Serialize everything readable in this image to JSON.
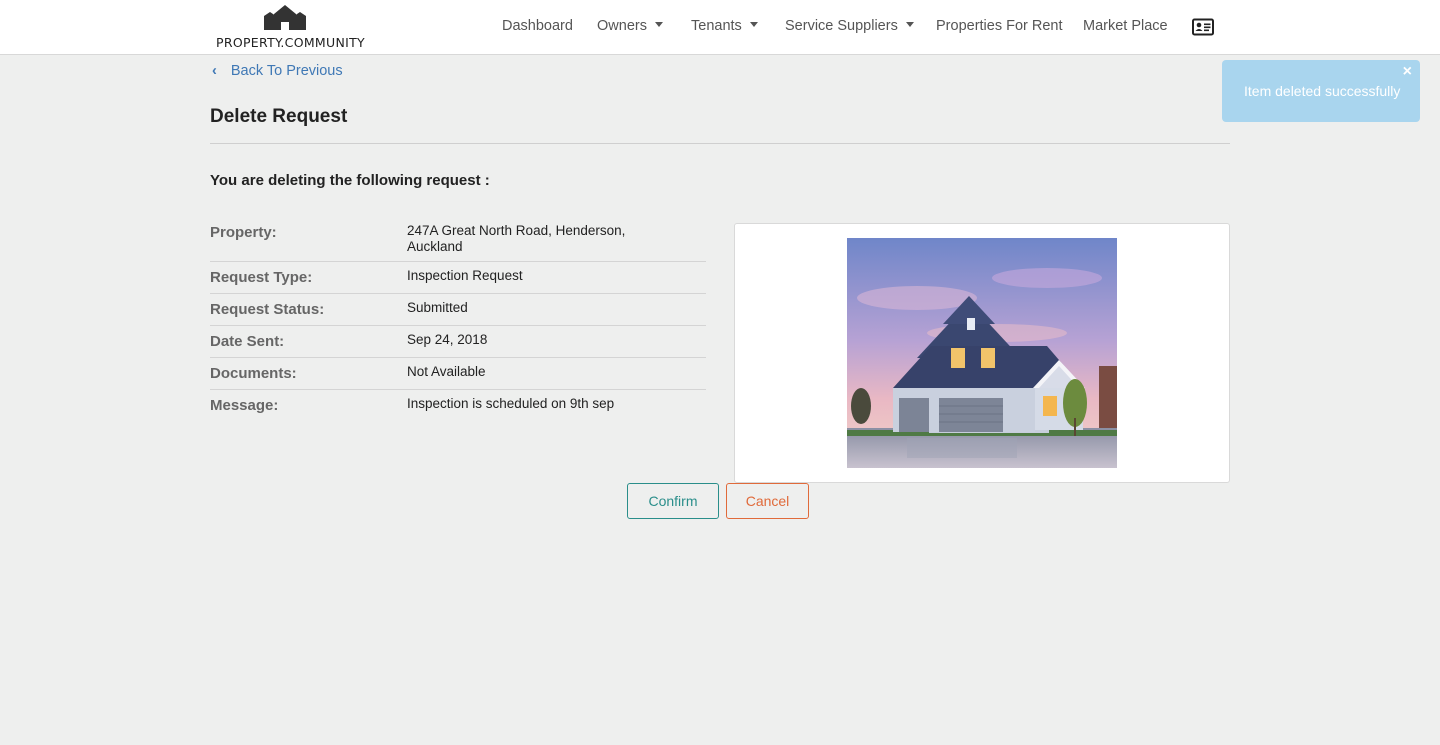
{
  "brand": {
    "name": "PROPERTY.COMMUNITY"
  },
  "nav": {
    "items": [
      {
        "label": "Dashboard"
      },
      {
        "label": "Owners"
      },
      {
        "label": "Tenants"
      },
      {
        "label": "Service Suppliers"
      },
      {
        "label": "Properties For Rent"
      },
      {
        "label": "Market Place"
      }
    ],
    "profile_icon": "id-card-icon"
  },
  "toast": {
    "message": "Item deleted successfully",
    "close": "×",
    "color": "#a9d5ee"
  },
  "back_link": {
    "label": "Back To Previous"
  },
  "page": {
    "title": "Delete Request",
    "intro": "You are deleting the following request :"
  },
  "details": {
    "property_label": "Property:",
    "property_value": "247A Great North Road, Henderson, Auckland",
    "type_label": "Request Type:",
    "type_value": "Inspection Request",
    "status_label": "Request Status:",
    "status_value": "Submitted",
    "date_label": "Date Sent:",
    "date_value": "Sep 24, 2018",
    "documents_label": "Documents:",
    "documents_value": "Not Available",
    "message_label": "Message:",
    "message_value": "Inspection is scheduled on 9th sep"
  },
  "actions": {
    "confirm": "Confirm",
    "cancel": "Cancel"
  },
  "colors": {
    "accent_link": "#3f78b5",
    "confirm": "#2a8e8a",
    "cancel": "#e06a3a"
  }
}
